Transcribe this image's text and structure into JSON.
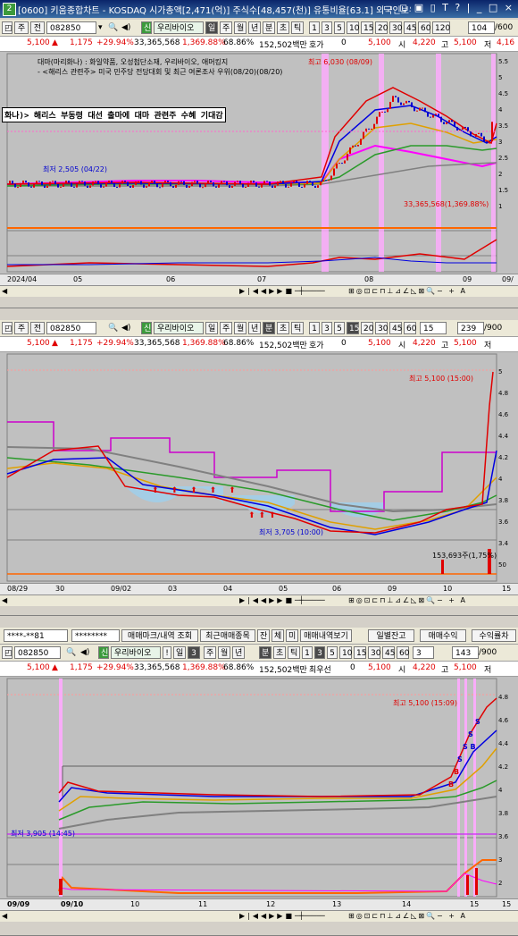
{
  "window": {
    "title": "[0600] 키움종합차트 - KOSDAQ 시가총액[2,471(억)] 주식수[48,457(천)] 유통비율[63.1] 외국인보유",
    "buttons": "▭ ◻ ▣ ▯ T ? | _ □ ×",
    "icon": "2"
  },
  "stock": {
    "code": "082850",
    "name": "우리바이오",
    "price": "5,100",
    "change": "1,175",
    "change_pct": "+29.94%",
    "volume": "33,365,568",
    "vol_ratio": "1,369.88%",
    "turnover": "68.86%",
    "amount": "152,502백만",
    "open_label": "시",
    "open": "4,220",
    "high_label": "고",
    "high": "5,100",
    "low_label": "저"
  },
  "toolbar_common": {
    "day": "주",
    "period_label": "전",
    "search_icon": "🔍",
    "sound_icon": "◀)",
    "badge_new": "신",
    "d": "일",
    "w": "주",
    "m": "월",
    "y": "년",
    "min": "분",
    "sec": "초",
    "tick": "틱",
    "intervals": [
      "1",
      "3",
      "5",
      "10",
      "15",
      "20",
      "30",
      "45",
      "60",
      "120"
    ]
  },
  "panel1": {
    "interval_sel": "",
    "count": "104",
    "count_total": "/600",
    "status_label": "호가",
    "status_val": "0",
    "news_lines": [
      "대마(마리화나) : 화일약품, 오성첨단소재, 우리바이오, 애머킹지",
      "- <해리스 관련주> 미국 민주당 전당대회 및 최근 여론조사 우위(08/20)(08/20)"
    ],
    "theme": "화나)> 해리스 부동령 대선 출마에 대마 관련주 수혜 기대감",
    "high_note": "최고 6,030 (08/09)",
    "low_note": "최저 2,505 (04/22)",
    "vol_note": "33,365,568(1,369.88%)",
    "yaxis": [
      "5.5",
      "5",
      "4.5",
      "4",
      "3.5",
      "3",
      "2.5",
      "2",
      "1.5",
      "1",
      "0.5"
    ],
    "xaxis": [
      "2024/04",
      "05",
      "06",
      "07",
      "08",
      "09",
      "09/"
    ]
  },
  "panel2": {
    "interval_sel": "15",
    "count": "239",
    "count_total": "/900",
    "status_label": "호가",
    "status_val": "0",
    "high_note": "최고 5,100 (15:00)",
    "low_note": "최저 3,705 (10:00)",
    "vol_note": "153,693주(1,75%)",
    "yaxis": [
      "5",
      "4.8",
      "4.6",
      "4.4",
      "4.2",
      "4",
      "3.8",
      "3.6",
      "3.4",
      "50",
      "15"
    ],
    "xaxis": [
      "08/29",
      "30",
      "09/02",
      "03",
      "04",
      "05",
      "06",
      "09",
      "10",
      "15"
    ]
  },
  "panel3": {
    "account": "****-**81",
    "password": "********",
    "btn_mark": "매매마크/내역 조회",
    "btn_recent": "최근매매종목",
    "btn_jan": "잔",
    "btn_che": "체",
    "btn_mi": "미",
    "btn_hist": "매매내역보기",
    "btn_daily": "일별잔고",
    "btn_profit": "매매수익",
    "btn_rate": "수익률차",
    "interval_sel": "3",
    "count": "143",
    "count_total": "/900",
    "status_label": "최우선",
    "status_val": "0",
    "high_note": "최고 5,100 (15:09)",
    "low_note": "최저 3,905 (14:45)",
    "yaxis": [
      "4.8",
      "4.6",
      "4.4",
      "4.2",
      "4",
      "3.8",
      "3.6",
      "3",
      "2"
    ],
    "xaxis": [
      "09/09",
      "09/10",
      "10",
      "11",
      "12",
      "13",
      "14",
      "15",
      "15"
    ]
  },
  "colors": {
    "up": "#e00000",
    "down": "#0000d0",
    "chart_bg": "#c0c0c0",
    "highlight": "#ff99ff"
  },
  "icons": {
    "search": "search-icon",
    "sound": "speaker-icon",
    "up_arrow": "up-arrow-icon"
  }
}
